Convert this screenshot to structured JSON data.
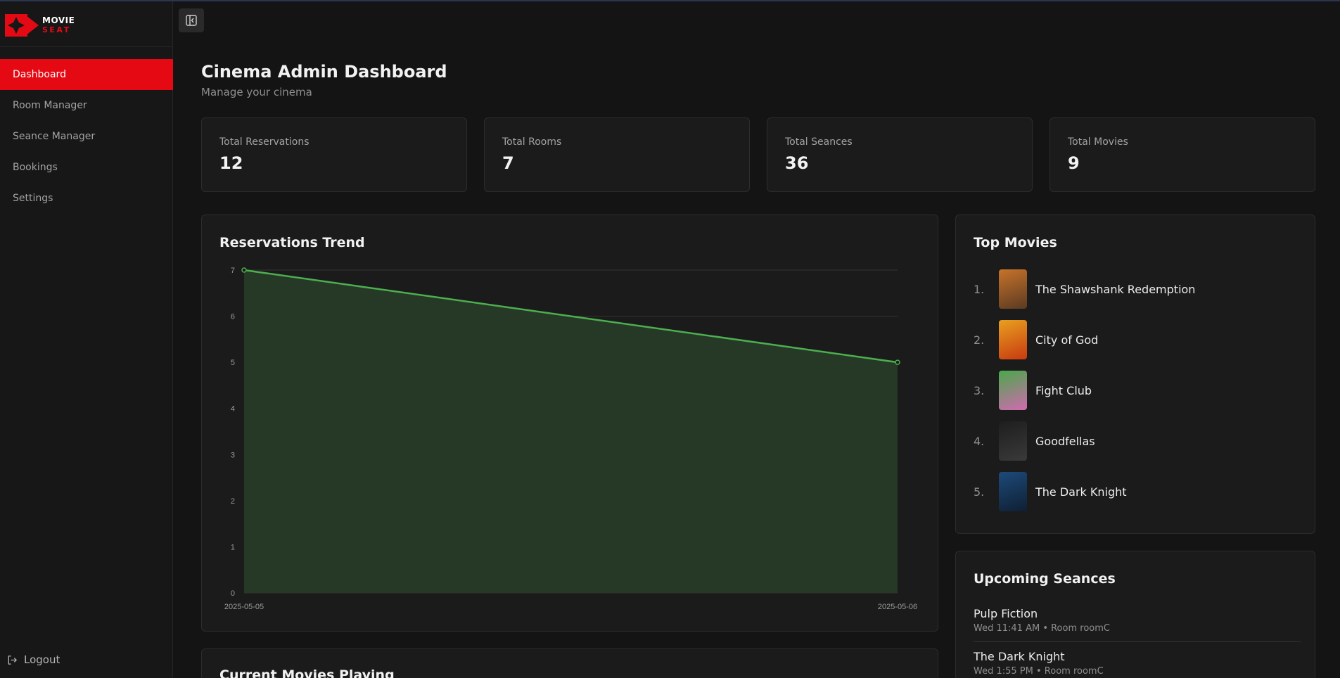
{
  "app": {
    "logo_line1": "MOVIE",
    "logo_line2": "SEAT",
    "brand_color": "#e50914"
  },
  "sidebar": {
    "items": [
      {
        "label": "Dashboard",
        "active": true
      },
      {
        "label": "Room Manager",
        "active": false
      },
      {
        "label": "Seance Manager",
        "active": false
      },
      {
        "label": "Bookings",
        "active": false
      },
      {
        "label": "Settings",
        "active": false
      }
    ],
    "logout_label": "Logout",
    "toggle_icon": "sidebar-collapse-icon"
  },
  "header": {
    "title": "Cinema Admin Dashboard",
    "subtitle": "Manage your cinema"
  },
  "stats": [
    {
      "label": "Total Reservations",
      "value": "12"
    },
    {
      "label": "Total Rooms",
      "value": "7"
    },
    {
      "label": "Total Seances",
      "value": "36"
    },
    {
      "label": "Total Movies",
      "value": "9"
    }
  ],
  "trend": {
    "title": "Reservations Trend"
  },
  "chart_data": {
    "type": "area",
    "x": [
      "2025-05-05",
      "2025-05-06"
    ],
    "series": [
      {
        "values": [
          7,
          5
        ]
      }
    ],
    "ylim": [
      0,
      7
    ],
    "yticks": [
      0,
      1,
      2,
      3,
      4,
      5,
      6,
      7
    ],
    "grid": true,
    "line_color": "#4caf50",
    "fill_color": "#263826"
  },
  "top_movies": {
    "title": "Top Movies",
    "items": [
      {
        "rank": "1.",
        "title": "The Shawshank Redemption",
        "poster_colors": [
          "#c8732a",
          "#5a3a22"
        ]
      },
      {
        "rank": "2.",
        "title": "City of God",
        "poster_colors": [
          "#e8a020",
          "#c83a10"
        ]
      },
      {
        "rank": "3.",
        "title": "Fight Club",
        "poster_colors": [
          "#4aa84a",
          "#d06ab0"
        ]
      },
      {
        "rank": "4.",
        "title": "Goodfellas",
        "poster_colors": [
          "#1e1e1e",
          "#3a3a3a"
        ]
      },
      {
        "rank": "5.",
        "title": "The Dark Knight",
        "poster_colors": [
          "#1d4a7a",
          "#0f1f33"
        ]
      }
    ]
  },
  "upcoming": {
    "title": "Upcoming Seances",
    "items": [
      {
        "movie": "Pulp Fiction",
        "meta": "Wed 11:41 AM • Room roomC"
      },
      {
        "movie": "The Dark Knight",
        "meta": "Wed 1:55 PM • Room roomC"
      }
    ]
  },
  "current_movies": {
    "title": "Current Movies Playing"
  }
}
